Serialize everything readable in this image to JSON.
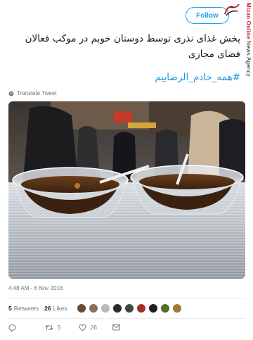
{
  "header": {
    "follow_label": "Follow",
    "watermark_brand": "Mizan Online",
    "watermark_rest": " News Agency"
  },
  "tweet": {
    "text": "پخش غذای نذری توسط دوستان خوبم در موکب فعالان فضای مجازی",
    "hashtag": "#همه_خادم_الرضاییم",
    "translate_label": "Translate Tweet",
    "timestamp": "4:48 AM - 6 Nov 2018"
  },
  "stats": {
    "retweets_count": "5",
    "retweets_label": "Retweets",
    "likes_count": "26",
    "likes_label": "Likes",
    "avatar_colors": [
      "#6b4a3a",
      "#8a6f5c",
      "#b9b9b9",
      "#2b2b2b",
      "#3d4a3f",
      "#a0302a",
      "#1f1f1f",
      "#5b6b2a",
      "#a07a3a"
    ]
  },
  "actions": {
    "retweet_count": "5",
    "like_count": "26"
  },
  "colors": {
    "accent": "#1da1f2",
    "hashtag": "#1b95e0",
    "muted": "#657786"
  }
}
